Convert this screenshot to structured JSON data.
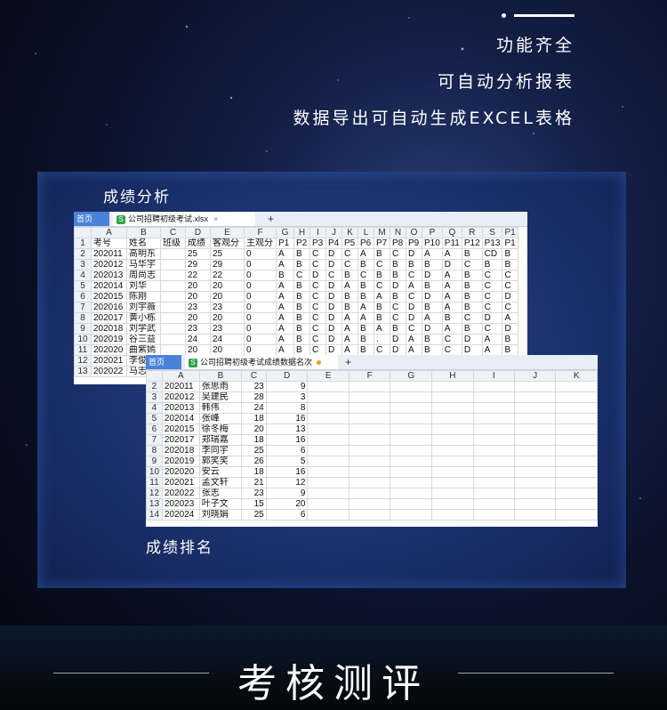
{
  "features": [
    "功能齐全",
    "可自动分析报表",
    "数据导出可自动生成EXCEL表格"
  ],
  "panel": {
    "label_top": "成绩分析",
    "label_bottom": "成绩排名"
  },
  "sheet1": {
    "home_tab": "首页",
    "file_tab": "公司招聘初级考试.xlsx",
    "columns": [
      "A",
      "B",
      "C",
      "D",
      "E",
      "F",
      "G",
      "H",
      "I",
      "J",
      "K",
      "L",
      "M",
      "N",
      "O",
      "P",
      "Q",
      "R",
      "S",
      "P1"
    ],
    "rows": [
      [
        "1",
        "考号",
        "姓名",
        "班级",
        "成绩",
        "客观分",
        "主观分",
        "P1",
        "P2",
        "P3",
        "P4",
        "P5",
        "P6",
        "P7",
        "P8",
        "P9",
        "P10",
        "P11",
        "P12",
        "P13",
        "P1"
      ],
      [
        "2",
        "202011",
        "高明东",
        "",
        "25",
        "25",
        "0",
        "A",
        "B",
        "C",
        "D",
        "C",
        "A",
        "B",
        "C",
        "D",
        "A",
        "A",
        "B",
        "CD",
        "B"
      ],
      [
        "3",
        "202012",
        "马华宇",
        "",
        "29",
        "29",
        "0",
        "A",
        "B",
        "C",
        "D",
        "C",
        "B",
        "C",
        "B",
        "B",
        "B",
        "D",
        "C",
        "B",
        "B"
      ],
      [
        "4",
        "202013",
        "周尚志",
        "",
        "22",
        "22",
        "0",
        "B",
        "C",
        "D",
        "C",
        "B",
        "C",
        "B",
        "B",
        "C",
        "D",
        "A",
        "B",
        "C",
        "C"
      ],
      [
        "5",
        "202014",
        "刘华",
        "",
        "20",
        "20",
        "0",
        "A",
        "B",
        "C",
        "D",
        "A",
        "B",
        "C",
        "D",
        "A",
        "B",
        "A",
        "B",
        "C",
        "C"
      ],
      [
        "6",
        "202015",
        "陈刚",
        "",
        "20",
        "20",
        "0",
        "A",
        "B",
        "C",
        "D",
        "B",
        "B",
        "A",
        "B",
        "C",
        "D",
        "A",
        "B",
        "C",
        "D"
      ],
      [
        "7",
        "202016",
        "刘宇薇",
        "",
        "23",
        "23",
        "0",
        "A",
        "B",
        "C",
        "D",
        "B",
        "A",
        "B",
        "C",
        "D",
        "B",
        "A",
        "B",
        "C",
        "C"
      ],
      [
        "8",
        "202017",
        "黄小栋",
        "",
        "20",
        "20",
        "0",
        "A",
        "B",
        "C",
        "D",
        "A",
        "A",
        "B",
        "C",
        "D",
        "A",
        "B",
        "C",
        "D",
        "A"
      ],
      [
        "9",
        "202018",
        "刘学武",
        "",
        "23",
        "23",
        "0",
        "A",
        "B",
        "C",
        "D",
        "A",
        "B",
        "A",
        "B",
        "C",
        "D",
        "A",
        "B",
        "C",
        "D"
      ],
      [
        "10",
        "202019",
        "谷三益",
        "",
        "24",
        "24",
        "0",
        "A",
        "B",
        "C",
        "D",
        "A",
        "B",
        ".",
        "D",
        "A",
        "B",
        "C",
        "D",
        "A",
        "B"
      ],
      [
        "11",
        "202020",
        "曲紫嫣",
        "",
        "20",
        "20",
        "0",
        "A",
        "B",
        "C",
        "D",
        "A",
        "B",
        "C",
        "D",
        "A",
        "B",
        "C",
        "D",
        "A",
        "B"
      ],
      [
        "12",
        "202021",
        "李俊",
        "",
        "",
        "",
        "",
        "",
        "",
        "",
        "",
        "",
        "",
        "",
        "",
        "",
        "",
        "",
        "",
        "",
        ""
      ],
      [
        "13",
        "202022",
        "马志",
        "",
        "",
        "",
        "",
        "",
        "",
        "",
        "",
        "",
        "",
        "",
        "",
        "",
        "",
        "",
        "",
        "",
        ""
      ]
    ]
  },
  "sheet2": {
    "home_tab": "首页",
    "file_tab": "公司招聘初级考试成绩数据名次",
    "columns": [
      "A",
      "B",
      "C",
      "D",
      "E",
      "F",
      "G",
      "H",
      "I",
      "J",
      "K"
    ],
    "rows": [
      [
        "2",
        "202011",
        "张思雨",
        "23",
        "9"
      ],
      [
        "3",
        "202012",
        "吴建民",
        "28",
        "3"
      ],
      [
        "4",
        "202013",
        "韩伟",
        "24",
        "8"
      ],
      [
        "5",
        "202014",
        "张峰",
        "18",
        "16"
      ],
      [
        "6",
        "202015",
        "徐冬梅",
        "20",
        "13"
      ],
      [
        "7",
        "202017",
        "郑瑞嘉",
        "18",
        "16"
      ],
      [
        "8",
        "202018",
        "李同宇",
        "25",
        "6"
      ],
      [
        "9",
        "202019",
        "郭笑笑",
        "26",
        "5"
      ],
      [
        "10",
        "202020",
        "安云",
        "18",
        "16"
      ],
      [
        "11",
        "202021",
        "孟文轩",
        "21",
        "12"
      ],
      [
        "12",
        "202022",
        "张志",
        "23",
        "9"
      ],
      [
        "13",
        "202023",
        "叶子文",
        "15",
        "20"
      ],
      [
        "14",
        "202024",
        "刘晓娟",
        "25",
        "6"
      ]
    ]
  },
  "bottom_title": "考核测评"
}
